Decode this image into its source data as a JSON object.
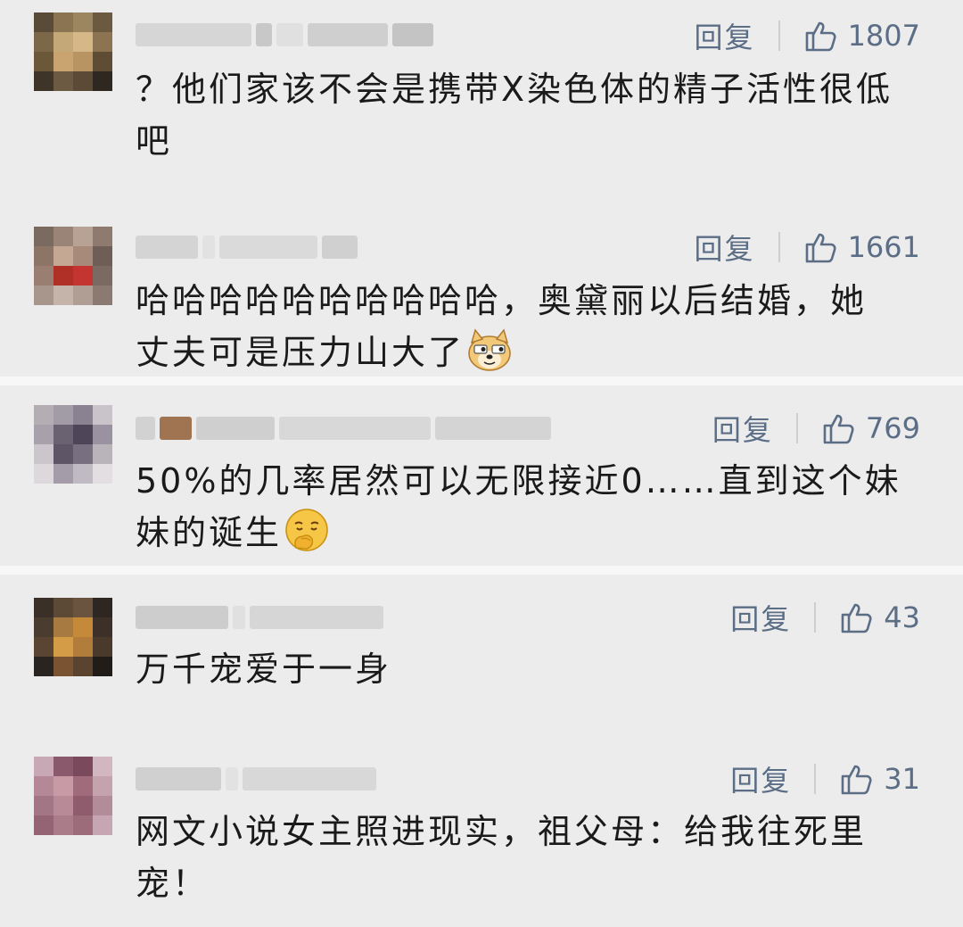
{
  "comments": [
    {
      "reply_label": "回复",
      "likes": "1807",
      "text": "？他们家该不会是携带X染色体的精子活性很低吧",
      "emoji": ""
    },
    {
      "reply_label": "回复",
      "likes": "1661",
      "text": "哈哈哈哈哈哈哈哈哈哈，奥黛丽以后结婚，她丈夫可是压力山大了",
      "emoji": "doge-emoji"
    },
    {
      "reply_label": "回复",
      "likes": "769",
      "text": "50%的几率居然可以无限接近0……直到这个妹妹的诞生",
      "emoji": "snicker-emoji"
    },
    {
      "reply_label": "回复",
      "likes": "43",
      "text": "万千宠爱于一身",
      "emoji": ""
    },
    {
      "reply_label": "回复",
      "likes": "31",
      "text": "网文小说女主照进现实，祖父母：给我往死里宠！",
      "emoji": ""
    }
  ],
  "colors": {
    "action": "#5b6e86",
    "text": "#1a1a1a",
    "background": "#ececec"
  },
  "icons": {
    "like": "thumbs-up-icon"
  }
}
